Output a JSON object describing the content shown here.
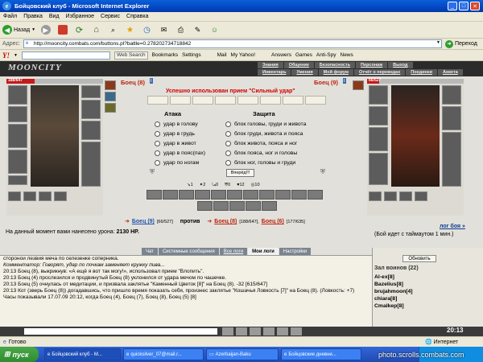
{
  "window": {
    "title": "Бойцовский клуб - Microsoft Internet Explorer",
    "logo_glyph": "e"
  },
  "menu": [
    "Файл",
    "Правка",
    "Вид",
    "Избранное",
    "Сервис",
    "Справка"
  ],
  "toolbar": {
    "back_label": "Назад"
  },
  "address": {
    "label": "Адрес:",
    "url": "http://mooncity.combats.com/buttons.pl?battle=0.278202734718842",
    "go_label": "Переход"
  },
  "yahoo_bar": {
    "logo": "Y!",
    "web_search": "Web Search",
    "bookmarks": "Bookmarks",
    "settings": "Settings",
    "mail": "Mail",
    "my_yahoo": "My Yahoo!",
    "answers": "Answers",
    "games": "Games",
    "antispy": "Anti-Spy",
    "news": "News"
  },
  "site": {
    "logo": "MOONCITY",
    "nav_top": [
      "Знания",
      "Общение",
      "Безопасность",
      "Персонаж",
      "Выход"
    ],
    "nav_bottom": [
      "Инвентарь",
      "Умения",
      "Мой форум",
      "Отчёт о переводах",
      "Поединки",
      "Анкета"
    ]
  },
  "fight": {
    "player_name": "Боец (8)",
    "opponent_name": "Боец (9)",
    "player_hp": "188/647",
    "opponent_hp": "66/527",
    "player_hp_fraction": 0.29,
    "opponent_hp_fraction": 0.125,
    "success_message": "Успешно использован прием \"Сильный удар\"",
    "attack_header": "Атака",
    "defense_header": "Защита",
    "attack_options": [
      "удар в голову",
      "удар в грудь",
      "удар в живот",
      "удар в пояс(пах)",
      "удар по ногам"
    ],
    "defense_options": [
      "блок головы, груди и живота",
      "блок груди, живота и пояса",
      "блок живота, пояса и ног",
      "блок пояса, ног и головы",
      "блок ног, головы и груди"
    ],
    "forward_button": "Вперёд!!!",
    "stats": [
      "1",
      "2",
      "0",
      "0",
      "12",
      "10"
    ],
    "vs_left_name": "Боец (9)",
    "vs_left_hp": "[66/527]",
    "vs_word": "против",
    "vs_right_name1": "Боец (8)",
    "vs_right_hp1": "[188/647],",
    "vs_right_name2": "Боец (6)",
    "vs_right_hp2": "[177/635]",
    "damage_prefix": "На данный момент вами нанесено урона:",
    "damage_value": "2130 HP.",
    "log_link": "лог боя »",
    "timeout_text": "(Бой идет с таймаутом 1 мин.)"
  },
  "chat": {
    "tabs": [
      "Чат",
      "Системные сообщения",
      "Все логи",
      "Мои логи",
      "Настройки"
    ],
    "lines": [
      "сторонои лезвия меча по селезенке соперника.",
      "Комментатор: Говорят, удар по почкам заменяет кружку пива...",
      "20:13 Боец (8), выкрикнув: «А ещё я вот так могу!», использовал прием \"Влопить\".",
      "20:13 Боец (4) прослезился и продвинутый Боец (8) уклонился от удара мечом по чашечке.",
      "20:13 Боец (5) очнулась от медитации, и призвала заклятье \"Каменный Цветок [8]\" на Боец (8). -32 [615/647]",
      "20:13 Кот (зверь Боец (8)) догадавшись, что пришло время показать себя, произнес заклятье \"Кошачья Ловкость [7]\" на Боец (8). (Ловкость: +7)",
      "Часы показывали 17.07.09 20:12, когда Боец (4), Боец (7), Боец (8), Боец (5) [8]"
    ],
    "refresh_button": "Обновить",
    "room_label": "Зал воинов (22)",
    "users": [
      "Al-ex[8]",
      "Bazelius[8]",
      "brujahmoon[4]",
      "chiara[8]",
      "Cmalkep[8]"
    ]
  },
  "status": {
    "left": "Готово",
    "zone": "Интернет"
  },
  "taskbar": {
    "start": "пуск",
    "tasks": [
      "Бойцовский клуб - M...",
      "quicksilver_07@mail.r...",
      "Azerbaijan-Baku",
      "Бойцовские дневни..."
    ],
    "clock": "20:13"
  },
  "watermark": "photo.scrolls.combats.com"
}
